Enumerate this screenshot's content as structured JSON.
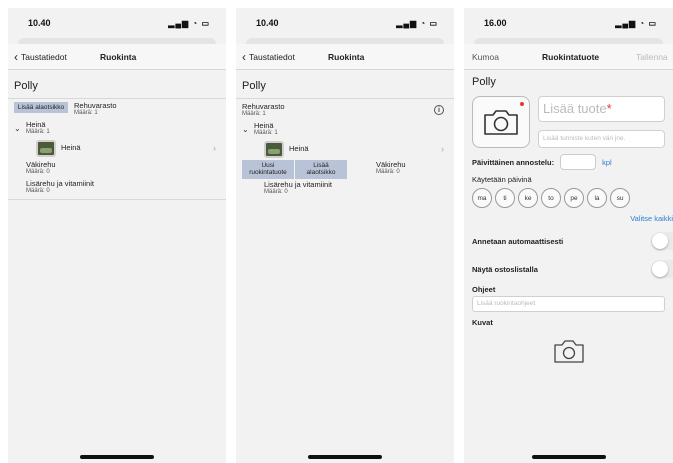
{
  "screen1": {
    "time": "10.40",
    "nav": {
      "back_label": "Taustatiedot",
      "title": "Ruokinta"
    },
    "animal_name": "Polly",
    "add_subcategory_label": "Lisää alaotsikko",
    "feed_stock": {
      "name": "Rehuvarasto",
      "count": "Määrä: 1"
    },
    "hay": {
      "name": "Heinä",
      "count": "Määrä: 1"
    },
    "hay_item": {
      "name": "Heinä"
    },
    "concentrate": {
      "name": "Väkirehu",
      "count": "Määrä: 0"
    },
    "supplements": {
      "name": "Lisärehu ja vitamiinit",
      "count": "Määrä: 0"
    }
  },
  "screen2": {
    "time": "10.40",
    "nav": {
      "back_label": "Taustatiedot",
      "title": "Ruokinta"
    },
    "animal_name": "Polly",
    "feed_stock": {
      "name": "Rehuvarasto",
      "count": "Määrä: 1"
    },
    "hay": {
      "name": "Heinä",
      "count": "Määrä: 1"
    },
    "hay_item": {
      "name": "Heinä"
    },
    "new_product_label": "Uusi ruokintatuote",
    "add_subcategory_label": "Lisää alaotsikko",
    "concentrate": {
      "name": "Väkirehu",
      "count": "Määrä: 0"
    },
    "supplements": {
      "name": "Lisärehu ja vitamiinit",
      "count": "Määrä: 0"
    }
  },
  "screen3": {
    "time": "16.00",
    "nav": {
      "cancel_label": "Kumoa",
      "title": "Ruokintatuote",
      "save_label": "Tallenna"
    },
    "animal_name": "Polly",
    "product_placeholder": "Lisää tuote",
    "identifier_placeholder": "Lisää tunniste kuten väri jne.",
    "daily_dose_label": "Päivittäinen annostelu:",
    "dose_unit": "kpl",
    "days_label": "Käytetään päivinä",
    "days": [
      "ma",
      "ti",
      "ke",
      "to",
      "pe",
      "la",
      "su"
    ],
    "select_all_label": "Valitse kaikki",
    "auto_label": "Annetaan automaattisesti",
    "shopping_label": "Näytä ostoslistalla",
    "instructions_label": "Ohjeet",
    "instructions_placeholder": "Lisää ruokintaohjeet",
    "images_label": "Kuvat"
  }
}
